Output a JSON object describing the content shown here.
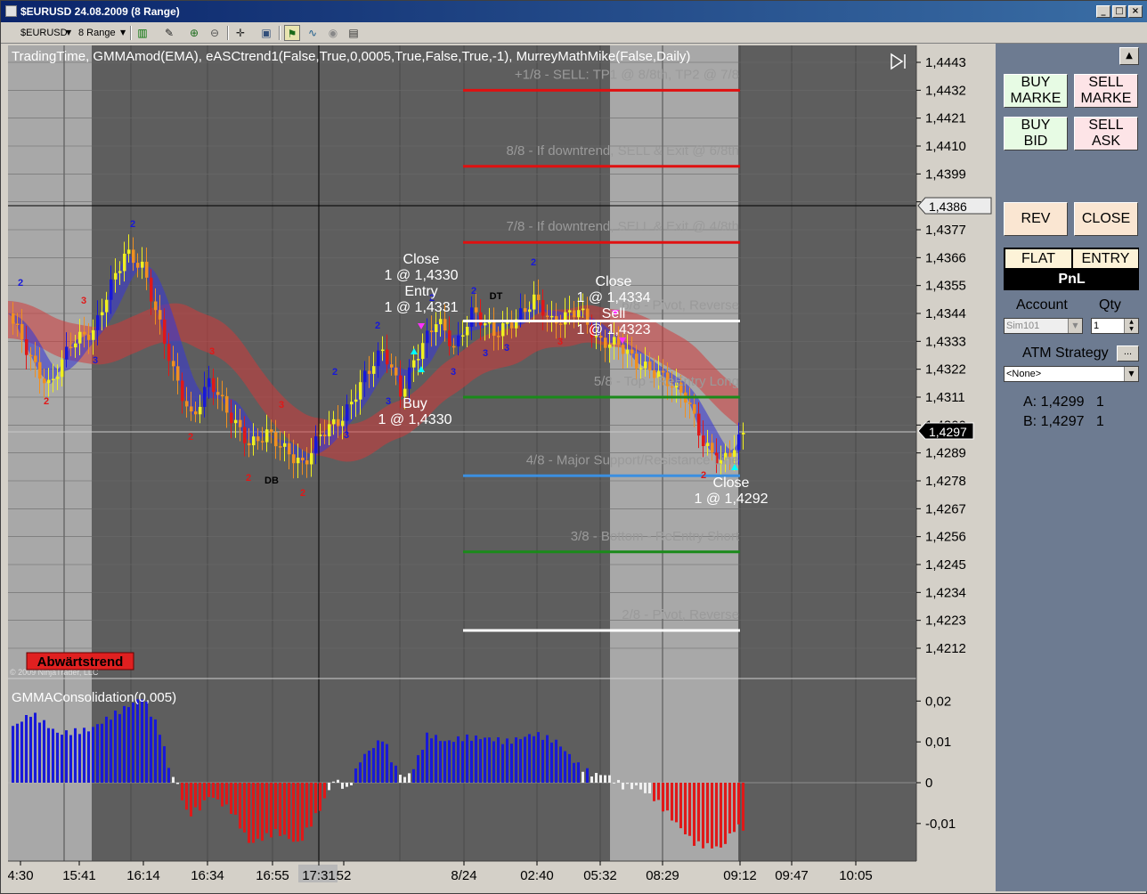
{
  "window": {
    "title": "$EURUSD  24.08.2009 (8 Range)",
    "controls": [
      "_",
      "□",
      "×"
    ]
  },
  "toolbar": {
    "instrument": "$EURUSD",
    "interval": "8 Range",
    "icons": [
      "candlestick-icon",
      "pencil-icon",
      "zoom-in-icon",
      "zoom-out-icon",
      "crosshair-icon",
      "properties-icon",
      "strategies-icon",
      "indicators-icon",
      "globe-icon",
      "data-box-icon"
    ]
  },
  "chart": {
    "indicator_line": "TradingTime,  GMMAmod(EMA),  eASCtrend1(False,True,0,0005,True,False,True,-1),  MurreyMathMike(False,Daily)",
    "copyright": "© 2009 NinjaTrader, LLC",
    "trend_label": "Abwärtstrend",
    "price_axis": [
      "1,4443",
      "1,4432",
      "1,4421",
      "1,4410",
      "1,4399",
      "1,4388",
      "1,4377",
      "1,4366",
      "1,4355",
      "1,4344",
      "1,4333",
      "1,4322",
      "1,4311",
      "1,4300",
      "1,4289",
      "1,4278",
      "1,4267",
      "1,4256",
      "1,4245",
      "1,4234",
      "1,4223",
      "1,4212"
    ],
    "current_price_tag": "1,4297",
    "crosshair_price_tag": "1,4386",
    "time_axis": [
      "4:30",
      "15:41",
      "16:14",
      "16:34",
      "16:55",
      "17:31",
      "52",
      "8/24",
      "02:40",
      "05:32",
      "08:29",
      "09:12",
      "09:47",
      "10:05"
    ],
    "highlight_time": "17:31",
    "murrey_lines": [
      {
        "label": "+1/8 - SELL: TP1 @ 8/8th, TP2 @ 7/8",
        "price": 1.4432,
        "color": "#e01010"
      },
      {
        "label": "8/8 - If downtrend, SELL & Exit @ 6/8th",
        "price": 1.4402,
        "color": "#e01010"
      },
      {
        "label": "7/8 - If downtrend, SELL & Exit @ 4/8th",
        "price": 1.4372,
        "color": "#e01010"
      },
      {
        "label": "6/8 - Pivot, Reverse",
        "price": 1.4341,
        "color": "#ffffff"
      },
      {
        "label": "5/8 - Top - ReEntry Long",
        "price": 1.4311,
        "color": "#1a8a1a"
      },
      {
        "label": "4/8 - Major Support/Resistance Line",
        "price": 1.428,
        "color": "#3b8fe0"
      },
      {
        "label": "3/8 - Bottom - ReEntry Short",
        "price": 1.425,
        "color": "#1a8a1a"
      },
      {
        "label": "2/8 - Pivot, Reverse",
        "price": 1.4219,
        "color": "#ffffff"
      }
    ],
    "trade_notes": [
      {
        "lines": [
          "Close",
          "1 @ 1,4330",
          "Entry",
          "1 @ 1,4331"
        ]
      },
      {
        "lines": [
          "Buy",
          "1 @ 1,4330"
        ]
      },
      {
        "lines": [
          "Close",
          "1 @ 1,4334",
          "Sell",
          "1 @ 1,4323"
        ]
      },
      {
        "lines": [
          "Close",
          "1 @ 1,4292"
        ]
      }
    ],
    "pattern_labels": [
      "DB",
      "DT"
    ],
    "swing_labels": [
      "2",
      "3"
    ]
  },
  "sub_panel": {
    "title": "GMMAConsolidation(0,005)",
    "axis": [
      "0,02",
      "0,01",
      "0",
      "-0,01"
    ]
  },
  "side_panel": {
    "buy_market": "BUY\nMARKE",
    "sell_market": "SELL\nMARKE",
    "buy_bid": "BUY\nBID",
    "sell_ask": "SELL\nASK",
    "rev": "REV",
    "close": "CLOSE",
    "flat": "FLAT",
    "entry": "ENTRY",
    "pnl": "PnL",
    "account_label": "Account",
    "account_value": "Sim101",
    "qty_label": "Qty",
    "qty_value": "1",
    "atm_label": "ATM Strategy",
    "atm_value": "<None>",
    "atm_more": "...",
    "bid_line": "A: 1,4299   1",
    "ask_line": "B: 1,4297   1"
  },
  "colors": {
    "chart_bg": "#7a7a7a",
    "session_dark": "#5e5e5e",
    "session_light": "#a8a8a8",
    "bull_bar": "#1818d8",
    "bear_bar": "#e01818",
    "neutral_bar": "#f0f0f0",
    "side_panel": "#6d7b91"
  }
}
